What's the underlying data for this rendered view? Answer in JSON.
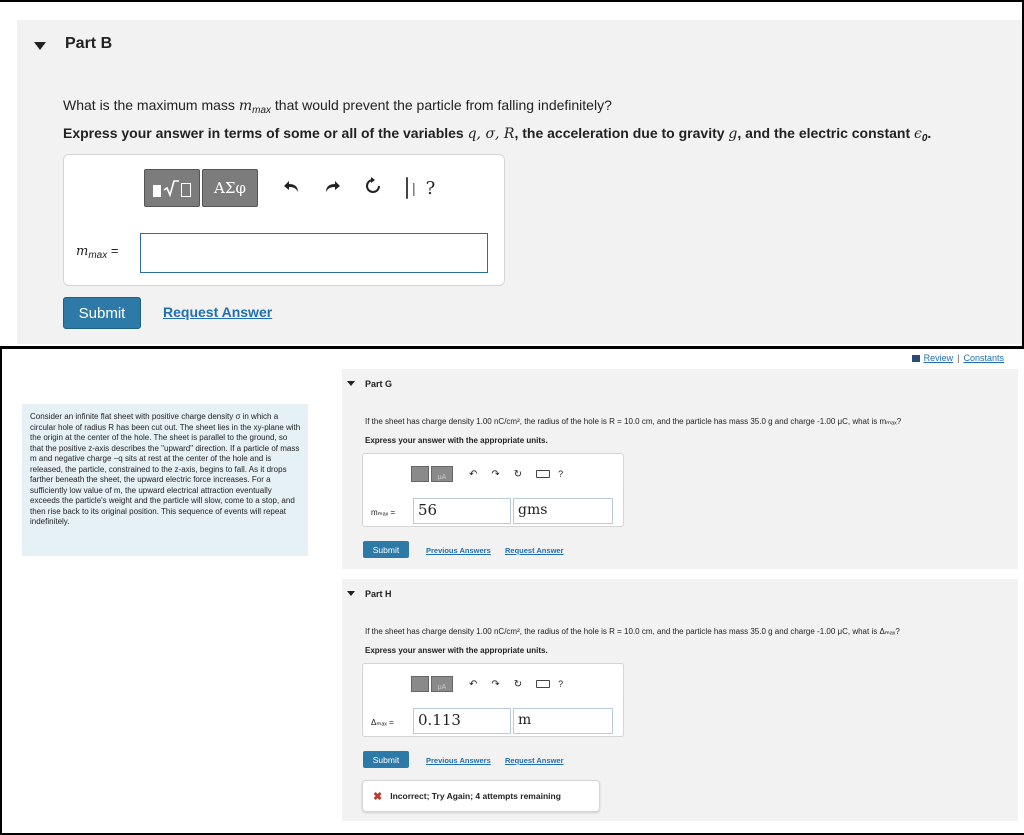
{
  "part_b": {
    "title": "Part B",
    "question_pre": "What is the maximum mass ",
    "question_var": "m",
    "question_sub": "max",
    "question_post": " that would prevent the particle from falling indefinitely?",
    "express_pre": "Express your answer in terms of some or all of the variables ",
    "express_vars": "q, σ, R",
    "express_mid": ", the acceleration due to gravity ",
    "express_g": "g",
    "express_mid2": ", and the electric constant ",
    "express_eps": "ϵ",
    "express_eps_sub": "0",
    "express_end": ".",
    "toolbar": {
      "greek_label": "ΑΣφ",
      "help_label": "?"
    },
    "answer_label_var": "m",
    "answer_label_sub": "max",
    "answer_label_eq": " =",
    "answer_value": "",
    "submit_label": "Submit",
    "request_label": "Request Answer"
  },
  "review": {
    "review_label": "Review",
    "separator": "|",
    "constants_label": "Constants"
  },
  "context_text": "Consider an infinite flat sheet with positive charge density σ in which a circular hole of radius R has been cut out. The sheet lies in the xy-plane with the origin at the center of the hole. The sheet is parallel to the ground, so that the positive z-axis describes the \"upward\" direction. If a particle of mass m and negative charge −q sits at rest at the center of the hole and is released, the particle, constrained to the z-axis, begins to fall. As it drops farther beneath the sheet, the upward electric force increases. For a sufficiently low value of m, the upward electrical attraction eventually exceeds the particle's weight and the particle will slow, come to a stop, and then rise back to its original position. This sequence of events will repeat indefinitely.",
  "part_g": {
    "title": "Part G",
    "question": "If the sheet has charge density 1.00 nC/cm², the radius of the hole is R = 10.0 cm, and the particle has mass 35.0 g and charge -1.00 μC, what is mₘₐₓ?",
    "express": "Express your answer with the appropriate units.",
    "label": "mₘₐₓ =",
    "value": "56",
    "unit": "gms",
    "submit_label": "Submit",
    "previous_label": "Previous Answers",
    "request_label": "Request Answer"
  },
  "part_h": {
    "title": "Part H",
    "question": "If the sheet has charge density 1.00 nC/cm², the radius of the hole is R = 10.0 cm, and the particle has mass 35.0 g and charge -1.00 μC, what is Δₘₐₓ?",
    "express": "Express your answer with the appropriate units.",
    "label": "Δₘₐₓ =",
    "value": "0.113",
    "unit": "m",
    "submit_label": "Submit",
    "previous_label": "Previous Answers",
    "request_label": "Request Answer",
    "feedback": "Incorrect; Try Again; 4 attempts remaining"
  },
  "colors": {
    "accent": "#2d7aa8",
    "link": "#1f6fb0",
    "panel": "#f2f2f2",
    "context_bg": "#e6f1f5",
    "error": "#c0392b"
  }
}
